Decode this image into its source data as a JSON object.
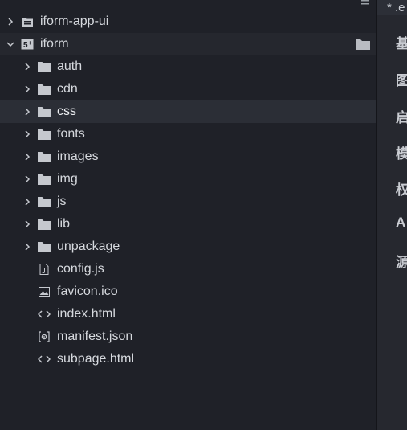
{
  "explorer": {
    "project_root": {
      "label": "iform-app-ui",
      "icon": "project-icon",
      "expanded": false
    },
    "project": {
      "label": "iform",
      "icon": "project-icon",
      "expanded": true
    },
    "folders": [
      {
        "label": "auth"
      },
      {
        "label": "cdn"
      },
      {
        "label": "css",
        "selected": true
      },
      {
        "label": "fonts"
      },
      {
        "label": "images"
      },
      {
        "label": "img"
      },
      {
        "label": "js"
      },
      {
        "label": "lib"
      },
      {
        "label": "unpackage"
      }
    ],
    "files": [
      {
        "label": "config.js",
        "icon": "js-file-icon"
      },
      {
        "label": "favicon.ico",
        "icon": "image-file-icon"
      },
      {
        "label": "index.html",
        "icon": "html-file-icon"
      },
      {
        "label": "manifest.json",
        "icon": "json-file-icon"
      },
      {
        "label": "subpage.html",
        "icon": "html-file-icon"
      }
    ]
  },
  "editor": {
    "tab_label": "* .e",
    "headings": [
      "基",
      "图",
      "启",
      "模",
      "权",
      "A",
      "源"
    ]
  },
  "colors": {
    "background": "#1f2128",
    "selected_row": "#2b2e36",
    "text": "#d6d9de",
    "icon": "#c5c8ce"
  }
}
